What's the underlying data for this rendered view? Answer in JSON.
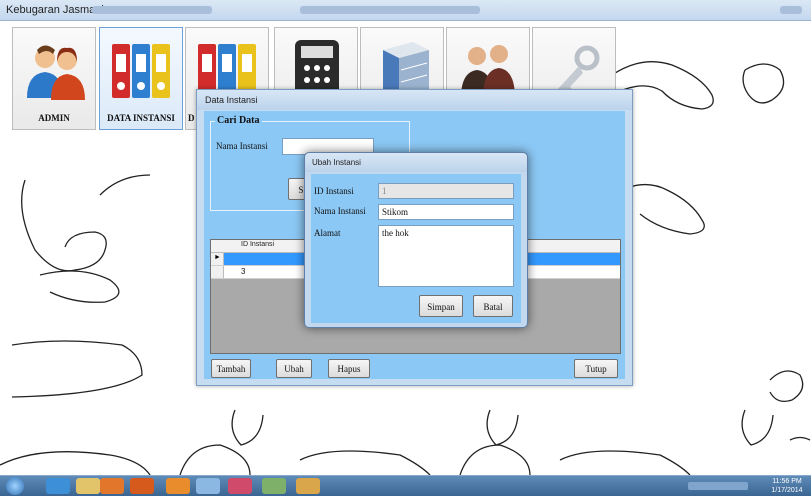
{
  "window": {
    "title": "Kebugaran Jasmani"
  },
  "toolbar": [
    {
      "label": "ADMIN",
      "icon": "users-icon"
    },
    {
      "label": "DATA INSTANSI",
      "icon": "binders-icon"
    },
    {
      "label": "D",
      "icon": "binders-icon"
    },
    {
      "label": "",
      "icon": "calculator-icon"
    },
    {
      "label": "",
      "icon": "cabinet-icon"
    },
    {
      "label": "",
      "icon": "people-icon"
    },
    {
      "label": "",
      "icon": "key-icon"
    }
  ],
  "data_instansi": {
    "title": "Data Instansi",
    "group_title": "Cari Data",
    "search_label": "Nama Instansi",
    "search_value": "",
    "search_button": "S",
    "grid": {
      "header": "ID Instansi",
      "rows": [
        "",
        "3"
      ]
    },
    "buttons": {
      "tambah": "Tambah",
      "ubah": "Ubah",
      "hapus": "Hapus",
      "tutup": "Tutup"
    }
  },
  "ubah_instansi": {
    "title": "Ubah Instansi",
    "id_label": "ID Instansi",
    "id_value": "1",
    "nama_label": "Nama Instansi",
    "nama_value": "Stikom",
    "alamat_label": "Alamat",
    "alamat_value": "the hok",
    "simpan": "Simpan",
    "batal": "Batal"
  },
  "taskbar": {
    "time": "11:56 PM",
    "date": "1/17/2014"
  }
}
